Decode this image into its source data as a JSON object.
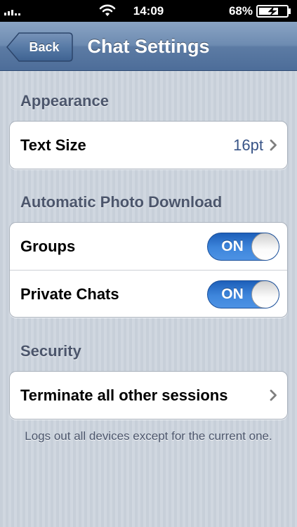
{
  "status_bar": {
    "time": "14:09",
    "battery": "68%",
    "signal_icon": "signal-bars-icon",
    "wifi_icon": "wifi-icon",
    "battery_icon": "battery-charging-icon"
  },
  "nav": {
    "title": "Chat Settings",
    "back_label": "Back"
  },
  "sections": {
    "appearance": {
      "header": "Appearance",
      "text_size_label": "Text Size",
      "text_size_value": "16pt"
    },
    "photo_download": {
      "header": "Automatic Photo Download",
      "groups_label": "Groups",
      "groups_toggle": "ON",
      "private_label": "Private Chats",
      "private_toggle": "ON"
    },
    "security": {
      "header": "Security",
      "terminate_label": "Terminate all other sessions",
      "footnote": "Logs out all devices except for the current one."
    }
  },
  "colors": {
    "nav_bar": "#6d8bb1",
    "toggle_on": "#3e86dc",
    "value_text": "#385487",
    "background": "#cbd2dc"
  }
}
